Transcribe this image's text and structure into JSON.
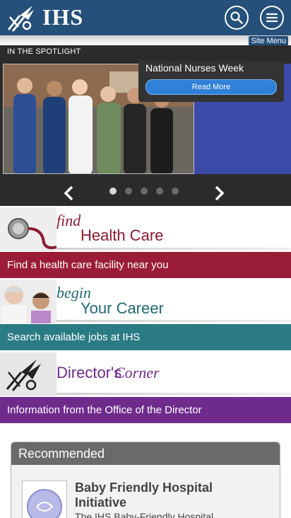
{
  "header": {
    "logo_text": "IHS",
    "site_menu_label": "Site Menu"
  },
  "spotlight": {
    "label": "IN THE SPOTLIGHT",
    "title": "National Nurses Week",
    "read_more": "Read More",
    "slide_count": 5,
    "active_slide": 1
  },
  "features": {
    "find": {
      "line1": "find",
      "line2": "Health Care",
      "bar_text": "Find a health care facility near you",
      "color": "#9b1c36"
    },
    "career": {
      "line1": "begin",
      "line2": "Your Career",
      "bar_text": "Search available jobs at IHS",
      "color": "#2a7b84"
    },
    "director": {
      "line1": "Director's",
      "line2": "Corner",
      "bar_text": "Information from the Office of the Director",
      "color": "#6f2b8c"
    }
  },
  "recommended": {
    "heading": "Recommended",
    "item_title": "Baby Friendly Hospital Initiative",
    "item_desc": "The IHS Baby-Friendly Hospital"
  },
  "colors": {
    "header_bg": "#25507a",
    "button_blue": "#2f80d6"
  }
}
